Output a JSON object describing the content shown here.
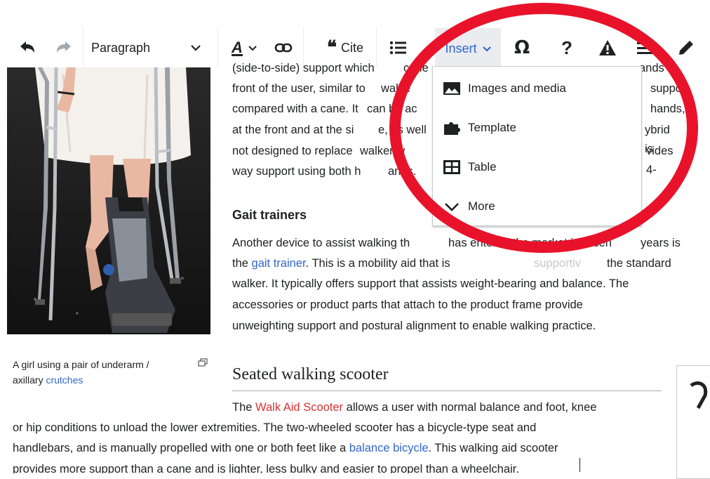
{
  "toolbar": {
    "format_label": "Paragraph",
    "cite_label": "Cite",
    "insert_label": "Insert"
  },
  "insert_menu": {
    "items": [
      {
        "label": "Images and media",
        "icon": "image-icon"
      },
      {
        "label": "Template",
        "icon": "puzzle-icon"
      },
      {
        "label": "Table",
        "icon": "table-icon"
      },
      {
        "label": "More",
        "icon": "chevron-down-icon"
      }
    ]
  },
  "article": {
    "lines_top": [
      "(side-to-side) support which",
      "cane",
      "ands",
      "front of the user, similar to",
      "walke",
      "suppor",
      "compared with a cane. It",
      "can be ac",
      "hands,",
      "at the front and at the si",
      "e, as well",
      "ybrid is",
      "not designed to replace",
      "walker w",
      "vides 4-",
      "way support using both h",
      "ands."
    ],
    "gait_heading": "Gait trainers",
    "gait_text": [
      "Another device to assist walking th",
      "has entered the market in recen",
      "years is",
      "the ",
      "gait trainer",
      ". This is a mobility aid that is",
      "supportiv",
      "the standard",
      "walker. It typically offers support that assists weight-bearing and balance. The",
      "accessories or product parts that attach to the product frame provide",
      "unweighting support and postural alignment to enable walking practice."
    ],
    "scooter_heading": "Seated walking scooter",
    "scooter_line1_pre": "The ",
    "scooter_link": "Walk Aid Scooter",
    "scooter_line1_post": " allows a user with normal balance and foot, knee",
    "scooter_line2": "or hip conditions to unload the lower extremities. The two-wheeled scooter has a bicycle-type seat and",
    "scooter_line3_pre": "handlebars, and is manually propelled with one or both feet like a ",
    "scooter_line3_link": "balance bicycle",
    "scooter_line3_post": ". This walking aid scooter",
    "scooter_line4": "provides more support than a cane and is lighter, less bulky and easier to propel than a wheelchair."
  },
  "figure": {
    "caption_pre": "A girl using a pair of underarm /",
    "caption_mid": "axillary ",
    "caption_link": "crutches"
  },
  "colors": {
    "highlight_circle": "#e8132a",
    "link": "#3366cc",
    "redlink": "#d73333",
    "insert_active": "#3366cc"
  }
}
